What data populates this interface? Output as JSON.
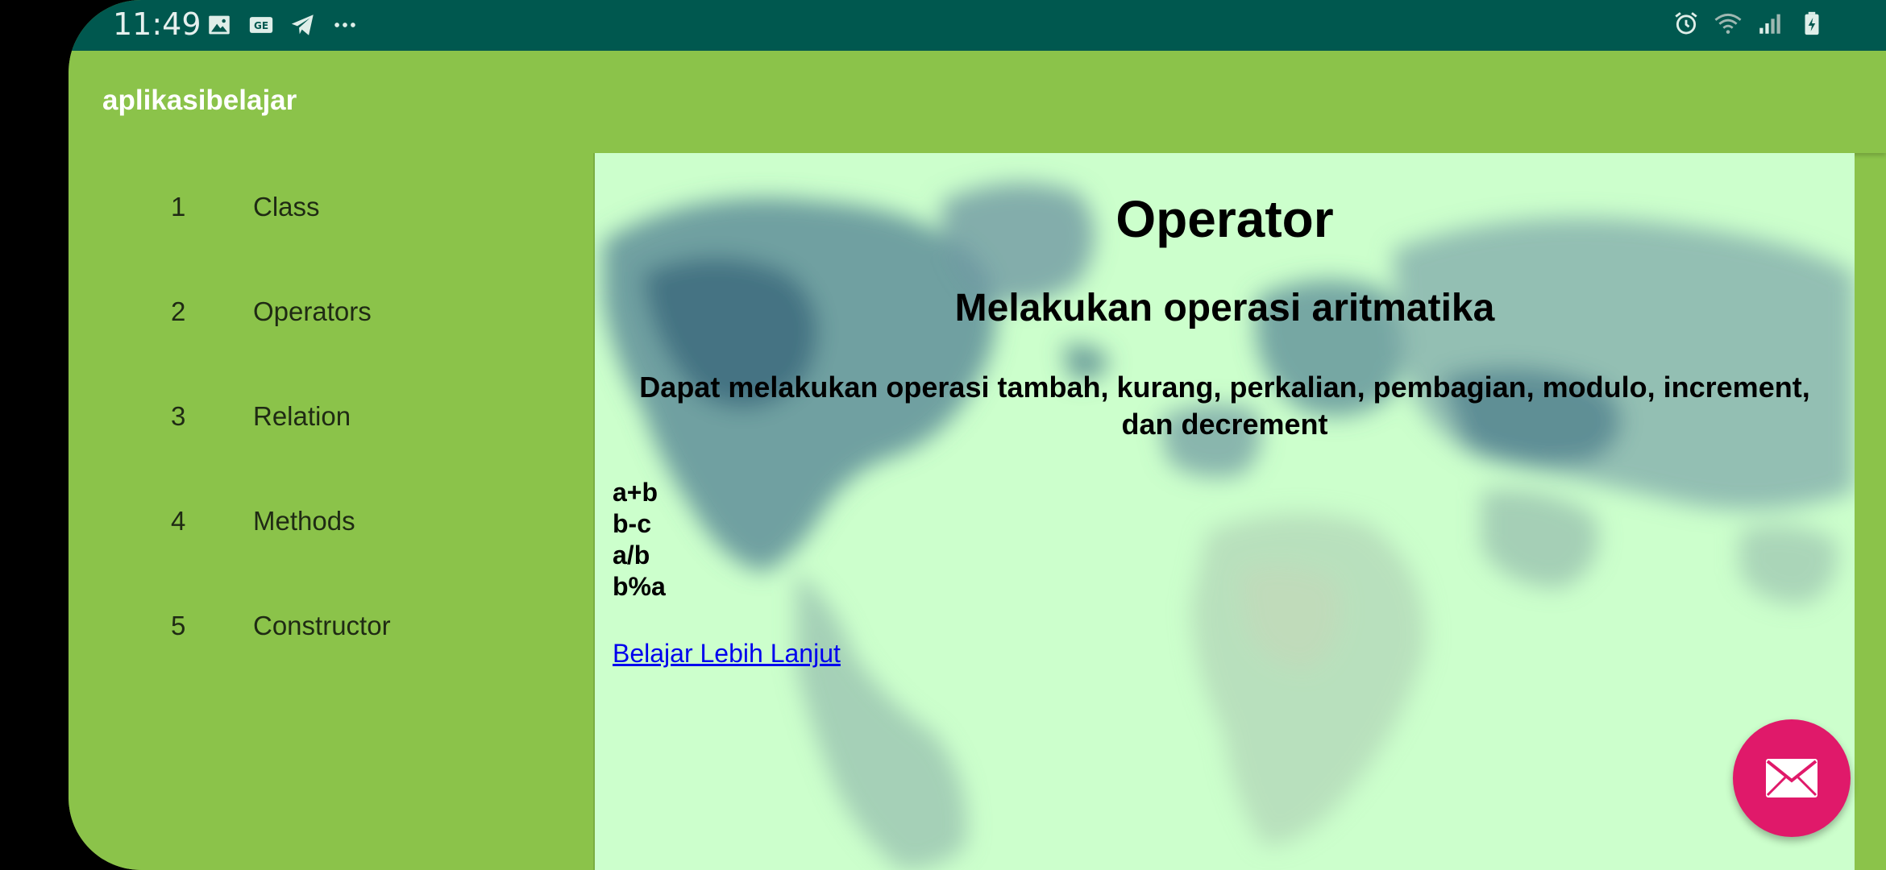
{
  "status_bar": {
    "time": "11:49",
    "left_icons": [
      "image-icon",
      "ge-icon",
      "telegram-icon",
      "more-icon"
    ],
    "right_icons": [
      "alarm-icon",
      "wifi-icon",
      "signal-icon",
      "battery-icon"
    ]
  },
  "app_bar": {
    "title": "aplikasibelajar"
  },
  "sidebar": {
    "items": [
      {
        "num": "1",
        "label": "Class"
      },
      {
        "num": "2",
        "label": "Operators"
      },
      {
        "num": "3",
        "label": "Relation"
      },
      {
        "num": "4",
        "label": "Methods"
      },
      {
        "num": "5",
        "label": "Constructor"
      }
    ]
  },
  "content": {
    "title": "Operator",
    "subtitle": "Melakukan operasi aritmatika",
    "description": "Dapat melakukan operasi tambah, kurang, perkalian, pembagian, modulo, increment, dan decrement",
    "examples": [
      "a+b",
      "b-c",
      "a/b",
      "b%a"
    ],
    "link_text": "Belajar Lebih Lanjut"
  },
  "fab": {
    "icon": "mail-icon",
    "color": "#e0196a"
  },
  "colors": {
    "status_bar": "#00584f",
    "app_bar": "#8bc34a",
    "content_bg": "#ccffcc",
    "link": "#0000ee"
  }
}
